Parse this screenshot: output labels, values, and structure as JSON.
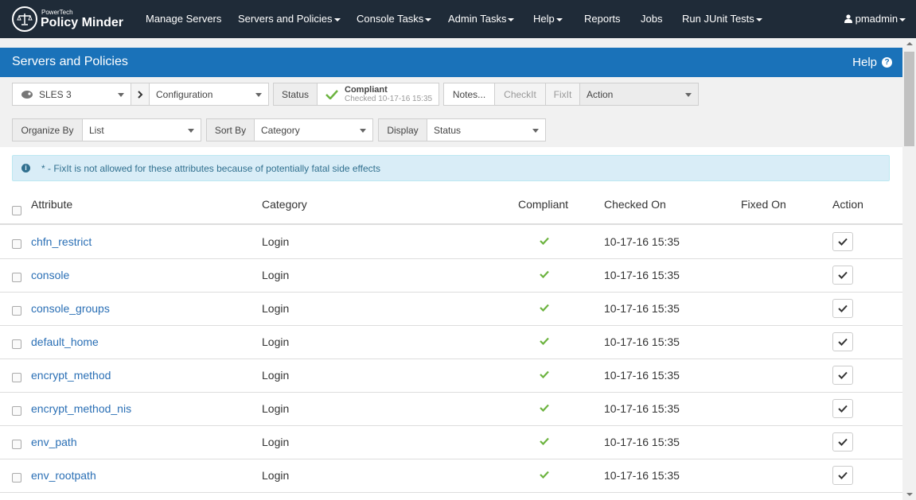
{
  "brand": {
    "small": "PowerTech",
    "name": "Policy Minder"
  },
  "nav": {
    "manage_servers": "Manage Servers",
    "servers_policies": "Servers and Policies",
    "console_tasks": "Console Tasks",
    "admin_tasks": "Admin Tasks",
    "help": "Help",
    "reports": "Reports",
    "jobs": "Jobs",
    "junit": "Run JUnit Tests",
    "user": "pmadmin"
  },
  "panel": {
    "title": "Servers and Policies",
    "help": "Help"
  },
  "toolbar": {
    "server": "SLES 3",
    "view": "Configuration",
    "status_label": "Status",
    "status_value": "Compliant",
    "status_checked": "Checked 10-17-16 15:35",
    "notes": "Notes...",
    "checkit": "CheckIt",
    "fixit": "FixIt",
    "action": "Action"
  },
  "filters": {
    "organize_label": "Organize By",
    "organize_value": "List",
    "sort_label": "Sort By",
    "sort_value": "Category",
    "display_label": "Display",
    "display_value": "Status"
  },
  "info": "* - FixIt is not allowed for these attributes because of potentially fatal side effects",
  "table": {
    "headers": {
      "attribute": "Attribute",
      "category": "Category",
      "compliant": "Compliant",
      "checked_on": "Checked On",
      "fixed_on": "Fixed On",
      "action": "Action"
    },
    "rows": [
      {
        "attribute": "chfn_restrict",
        "category": "Login",
        "checked_on": "10-17-16 15:35",
        "fixed_on": ""
      },
      {
        "attribute": "console",
        "category": "Login",
        "checked_on": "10-17-16 15:35",
        "fixed_on": ""
      },
      {
        "attribute": "console_groups",
        "category": "Login",
        "checked_on": "10-17-16 15:35",
        "fixed_on": ""
      },
      {
        "attribute": "default_home",
        "category": "Login",
        "checked_on": "10-17-16 15:35",
        "fixed_on": ""
      },
      {
        "attribute": "encrypt_method",
        "category": "Login",
        "checked_on": "10-17-16 15:35",
        "fixed_on": ""
      },
      {
        "attribute": "encrypt_method_nis",
        "category": "Login",
        "checked_on": "10-17-16 15:35",
        "fixed_on": ""
      },
      {
        "attribute": "env_path",
        "category": "Login",
        "checked_on": "10-17-16 15:35",
        "fixed_on": ""
      },
      {
        "attribute": "env_rootpath",
        "category": "Login",
        "checked_on": "10-17-16 15:35",
        "fixed_on": ""
      }
    ]
  },
  "colors": {
    "navbar": "#1f2b38",
    "header": "#1a72b9",
    "link": "#2a6fb5",
    "compliant": "#6cb33f"
  }
}
